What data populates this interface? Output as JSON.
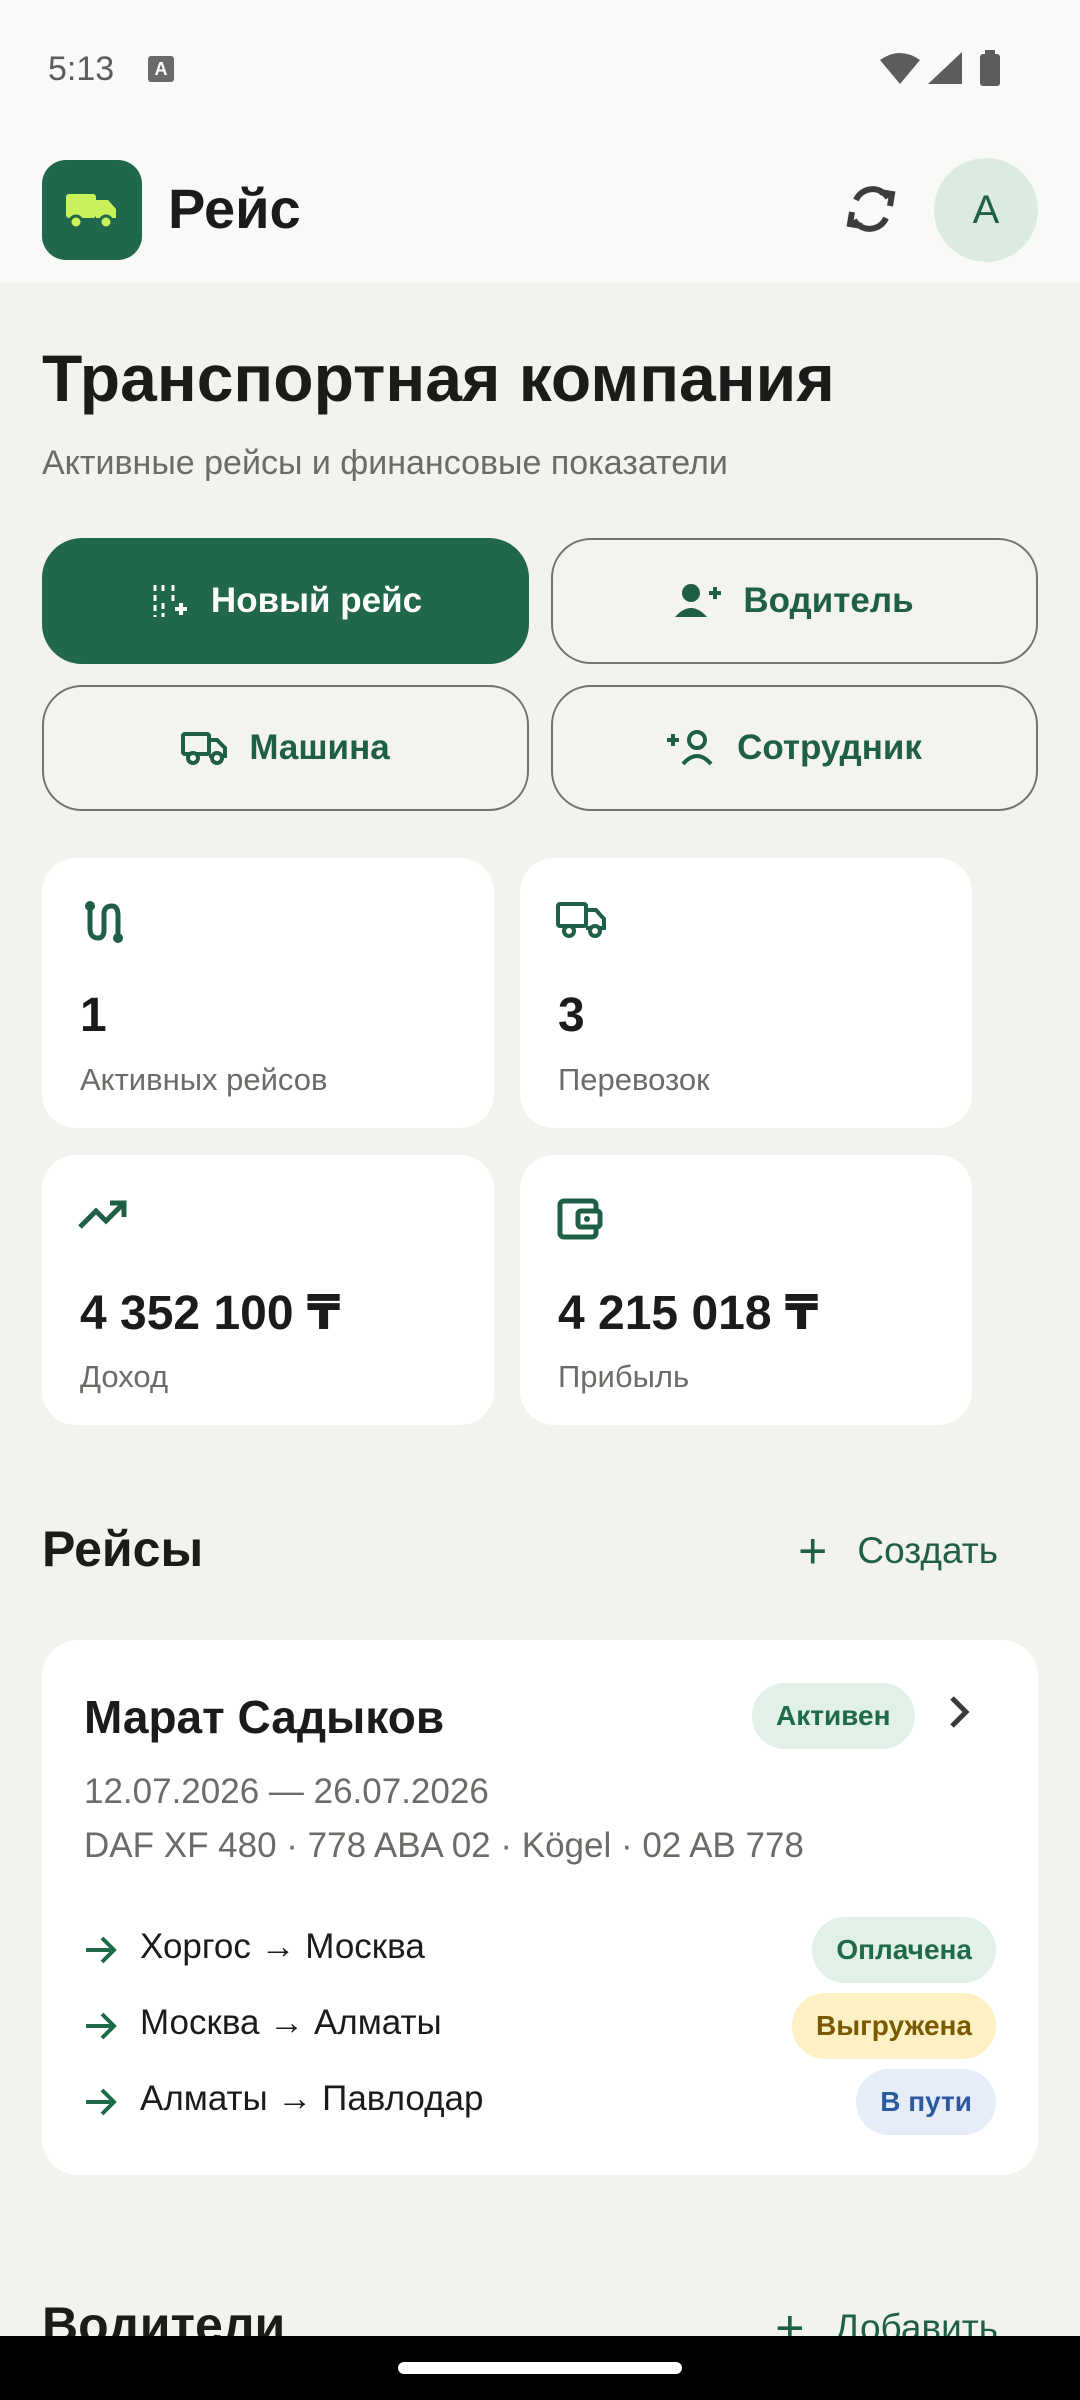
{
  "status_bar": {
    "time": "5:13",
    "notification_badge": "A",
    "icons": [
      "wifi-icon",
      "signal-icon",
      "battery-icon"
    ]
  },
  "app_bar": {
    "title": "Рейс",
    "avatar_letter": "А",
    "logo_icon": "truck-icon"
  },
  "header": {
    "title": "Транспортная компания",
    "subtitle": "Активные рейсы и финансовые показатели"
  },
  "actions": {
    "new_trip": "Новый рейс",
    "driver": "Водитель",
    "vehicle": "Машина",
    "employee": "Сотрудник"
  },
  "stats": [
    {
      "icon": "route-icon",
      "value": "1",
      "label": "Активных рейсов"
    },
    {
      "icon": "truck-icon",
      "value": "3",
      "label": "Перевозок"
    },
    {
      "icon": "trending-up-icon",
      "value": "4 352 100 ₸",
      "label": "Доход"
    },
    {
      "icon": "wallet-icon",
      "value": "4 215 018 ₸",
      "label": "Прибыль"
    }
  ],
  "trips_section": {
    "title": "Рейсы",
    "action": "Создать"
  },
  "trip": {
    "driver": "Марат Садыков",
    "status": "Активен",
    "dates": "12.07.2026 — 26.07.2026",
    "vehicle": "DAF XF 480 · 778 ABA 02 · Kögel · 02 AB 778",
    "routes": [
      {
        "text": "Хоргос → Москва",
        "status": "Оплачена"
      },
      {
        "text": "Москва → Алматы",
        "status": "Выгружена"
      },
      {
        "text": "Алматы → Павлодар",
        "status": "В пути"
      }
    ]
  },
  "drivers_section": {
    "title": "Водители",
    "action": "Добавить"
  },
  "colors": {
    "primary": "#21674a",
    "background": "#f2f2ee",
    "card": "#ffffff",
    "accent_icon": "#c9f25a"
  }
}
